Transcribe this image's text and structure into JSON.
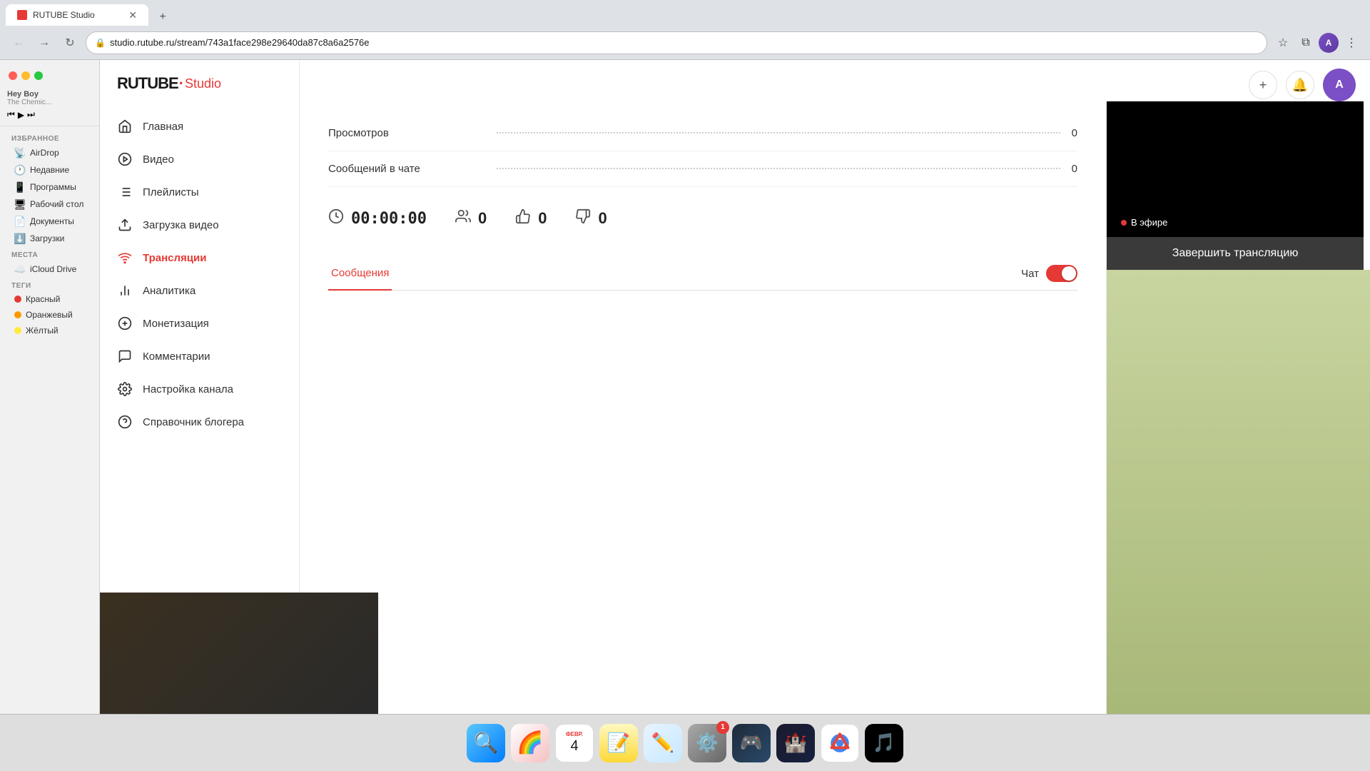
{
  "browser": {
    "url": "studio.rutube.ru/stream/743a1face298e29640da87c8a6a2576e",
    "tab_title": "RUTUBE Studio"
  },
  "finder": {
    "favorites_label": "Избранное",
    "places_label": "Места",
    "tags_label": "Теги",
    "items": [
      {
        "id": "airdrop",
        "label": "AirDrop",
        "icon": "📡"
      },
      {
        "id": "recent",
        "label": "Недавние",
        "icon": "🕐"
      },
      {
        "id": "programs",
        "label": "Программы",
        "icon": "📱"
      },
      {
        "id": "desktop",
        "label": "Рабочий стол",
        "icon": "🖥"
      },
      {
        "id": "docs",
        "label": "Документы",
        "icon": "📄"
      },
      {
        "id": "downloads",
        "label": "Загрузки",
        "icon": "⬇️"
      }
    ],
    "places": [
      {
        "id": "icloud",
        "label": "iCloud Drive",
        "icon": "☁️"
      }
    ],
    "tags": [
      {
        "id": "red",
        "label": "Красный",
        "color": "#e53935"
      },
      {
        "id": "orange",
        "label": "Оранжевый",
        "color": "#ff9800"
      },
      {
        "id": "yellow",
        "label": "Жёлтый",
        "color": "#ffeb3b"
      }
    ]
  },
  "rutube": {
    "logo_rutube": "RUTUBE",
    "logo_dot": "·",
    "logo_studio": "Studio",
    "header_icons": {
      "add": "+",
      "bell": "🔔"
    },
    "nav": [
      {
        "id": "home",
        "label": "Главная",
        "icon": "home",
        "active": false
      },
      {
        "id": "video",
        "label": "Видео",
        "icon": "play",
        "active": false
      },
      {
        "id": "playlists",
        "label": "Плейлисты",
        "icon": "list",
        "active": false
      },
      {
        "id": "upload",
        "label": "Загрузка видео",
        "icon": "upload",
        "active": false
      },
      {
        "id": "streams",
        "label": "Трансляции",
        "icon": "broadcast",
        "active": true
      },
      {
        "id": "analytics",
        "label": "Аналитика",
        "icon": "analytics",
        "active": false
      },
      {
        "id": "monetize",
        "label": "Монетизация",
        "icon": "money",
        "active": false
      },
      {
        "id": "comments",
        "label": "Комментарии",
        "icon": "comment",
        "active": false
      },
      {
        "id": "settings",
        "label": "Настройка канала",
        "icon": "settings",
        "active": false
      },
      {
        "id": "help",
        "label": "Справочник блогера",
        "icon": "info",
        "active": false
      }
    ],
    "stats": [
      {
        "label": "Просмотров",
        "value": "0"
      },
      {
        "label": "Сообщений в чате",
        "value": "0"
      }
    ],
    "metrics": {
      "timer": "00:00:00",
      "viewers": "0",
      "likes": "0",
      "dislikes": "0"
    },
    "preview": {
      "live_text": "В эфире"
    },
    "end_stream_button": "Завершить трансляцию",
    "messages_tab": "Сообщения",
    "chat_label": "Чат"
  },
  "dock": {
    "items": [
      {
        "id": "finder",
        "icon": "🔍",
        "bg": "#e8e8e8"
      },
      {
        "id": "photos",
        "icon": "🖼",
        "bg": "#f5c242"
      },
      {
        "id": "calendar",
        "icon": "📅",
        "bg": "#fff",
        "badge": "",
        "label": "ФЕВР.\n4"
      },
      {
        "id": "notes",
        "icon": "📝",
        "bg": "#fef9c0"
      },
      {
        "id": "freeform",
        "icon": "🎨",
        "bg": "#fff"
      },
      {
        "id": "prefs",
        "icon": "⚙️",
        "bg": "#888",
        "badge": "1"
      },
      {
        "id": "steam",
        "icon": "🎮",
        "bg": "#1e2a3a"
      },
      {
        "id": "castle",
        "icon": "🏰",
        "bg": "#1a1a2e"
      },
      {
        "id": "chrome",
        "icon": "🔵",
        "bg": "#fff"
      },
      {
        "id": "spotify",
        "icon": "🎵",
        "bg": "#1db954"
      }
    ]
  }
}
